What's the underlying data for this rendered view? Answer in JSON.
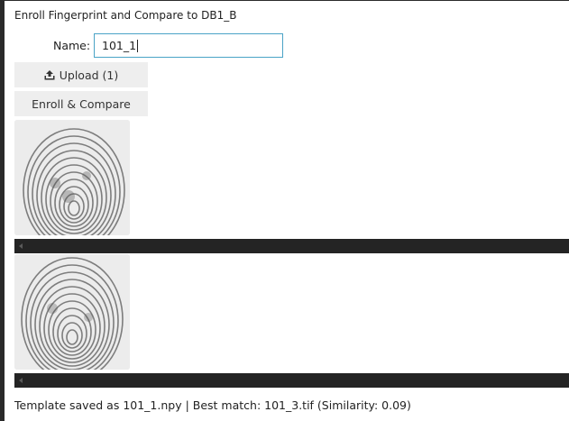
{
  "window": {
    "title": "Enroll Fingerprint and Compare to DB1_B"
  },
  "form": {
    "name_label": "Name:",
    "name_value": "101_1"
  },
  "buttons": {
    "upload_label": "Upload (1)",
    "upload_icon": "upload-icon",
    "enroll_label": "Enroll & Compare"
  },
  "images": [
    {
      "name": "enrolled-fingerprint"
    },
    {
      "name": "best-match-fingerprint"
    }
  ],
  "status": {
    "text": "Template saved as 101_1.npy | Best match: 101_3.tif (Similarity: 0.09)"
  },
  "colors": {
    "input_border": "#4aa3c6",
    "button_bg": "#eeeeee",
    "scrollbar_bg": "#242424"
  }
}
